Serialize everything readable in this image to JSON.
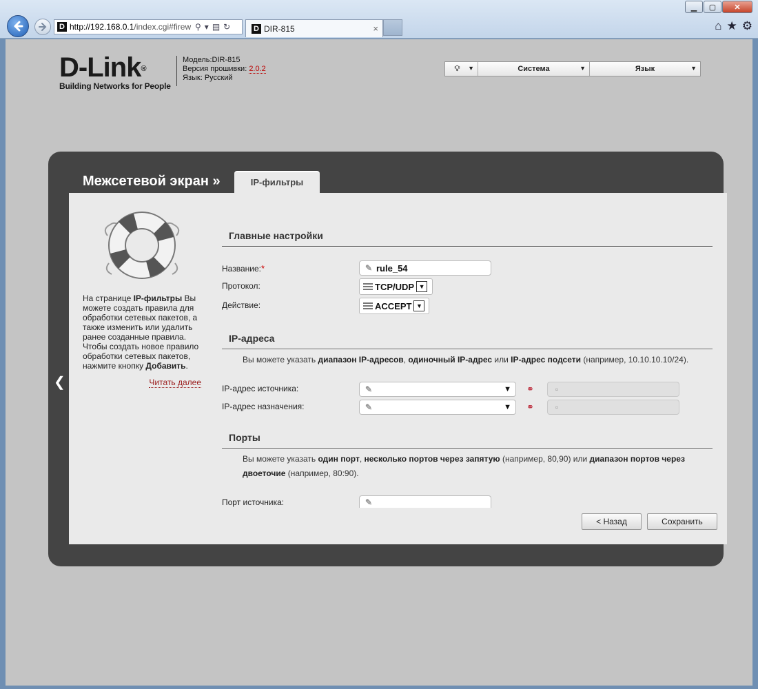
{
  "browser": {
    "url_host": "http://192.168.0.1",
    "url_path": "/index.cgi#firew",
    "tab_title": "DIR-815",
    "tab_close": "×"
  },
  "header": {
    "logo_text": "D-Link",
    "logo_mark": "®",
    "logo_tagline": "Building Networks for People",
    "model": "Модель:DIR-815",
    "firmware_label": "Версия прошивки:",
    "firmware_version": "2.0.2",
    "language": "Язык: Русский",
    "menu": {
      "system": "Система",
      "language": "Язык"
    }
  },
  "nav": {
    "section": "Межсетевой экран »",
    "tab": "IP-фильтры"
  },
  "help": {
    "text_1": "На странице ",
    "text_bold_1": "IP-фильтры",
    "text_2": " Вы можете создать правила для обработки сетевых пакетов, а также изменить или удалить ранее созданные правила. Чтобы создать новое правило обработки сетевых пакетов, нажмите кнопку ",
    "text_bold_2": "Добавить",
    "text_3": ".",
    "read_more": "Читать далее"
  },
  "main_settings": {
    "title": "Главные настройки",
    "name_label": "Название:",
    "required_mark": "*",
    "name_value": "rule_54",
    "protocol_label": "Протокол:",
    "protocol_value": "TCP/UDP",
    "action_label": "Действие:",
    "action_value": "ACCEPT"
  },
  "ip_addresses": {
    "title": "IP-адреса",
    "hint_1": "Вы можете указать ",
    "hint_b1": "диапазон IP-адресов",
    "hint_2": ", ",
    "hint_b2": "одиночный IP-адрес",
    "hint_3": " или ",
    "hint_b3": "IP-адрес подсети",
    "hint_4": " (например, 10.10.10.10/24).",
    "source_label": "IP-адрес источника:",
    "dest_label": "IP-адрес назначения:"
  },
  "ports": {
    "title": "Порты",
    "hint_1": "Вы можете указать ",
    "hint_b1": "один порт",
    "hint_2": ", ",
    "hint_b2": "несколько портов через запятую",
    "hint_3": " (например, 80,90) или ",
    "hint_b3": "диапазон портов через двоеточие",
    "hint_4": " (например, 80:90).",
    "source_port_label": "Порт источника:"
  },
  "buttons": {
    "back": "< Назад",
    "save": "Сохранить"
  },
  "icons": {
    "back": "arrow-left-icon",
    "forward": "arrow-right-icon",
    "search": "search-icon",
    "refresh": "refresh-icon",
    "home": "home-icon",
    "favorites": "star-icon",
    "settings": "gear-icon",
    "help": "lifebuoy-icon"
  }
}
